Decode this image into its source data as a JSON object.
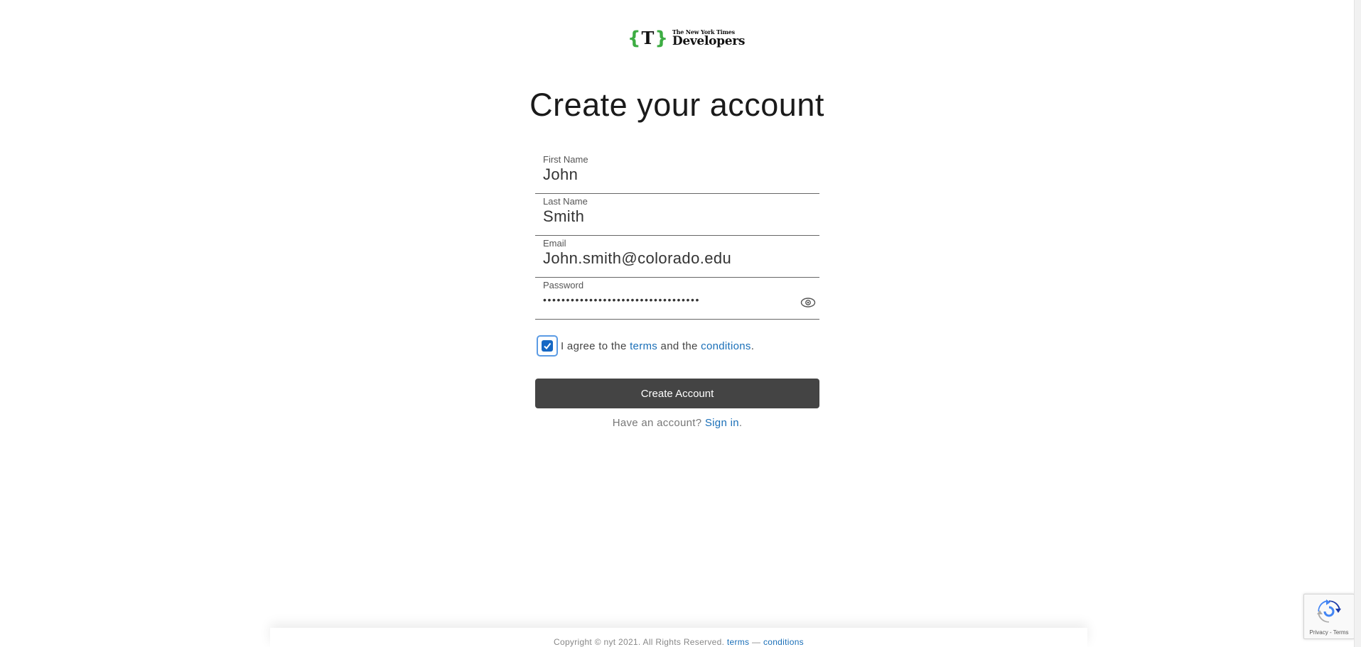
{
  "logo": {
    "brace_left": "{",
    "mark": "T",
    "brace_right": "}",
    "publisher": "The New York Times",
    "product": "Developers"
  },
  "title": "Create your account",
  "form": {
    "first_name": {
      "label": "First Name",
      "value": "John"
    },
    "last_name": {
      "label": "Last Name",
      "value": "Smith"
    },
    "email": {
      "label": "Email",
      "value": "John.smith@colorado.edu"
    },
    "password": {
      "label": "Password",
      "masked_value": "••••••••••••••••••••••••••••••••••",
      "toggle_icon": "eye-icon"
    },
    "agree": {
      "checked": true,
      "prefix": "I agree to the ",
      "terms_link": "terms",
      "middle": " and the ",
      "conditions_link": "conditions",
      "suffix": "."
    },
    "submit_label": "Create Account",
    "have_account_text": "Have an account? ",
    "sign_in_link": "Sign in",
    "sign_in_suffix": "."
  },
  "footer": {
    "copyright": "Copyright © nyt 2021. All Rights Reserved. ",
    "terms_link": "terms",
    "separator": " — ",
    "conditions_link": "conditions"
  },
  "recaptcha": {
    "privacy": "Privacy",
    "separator": " - ",
    "terms": "Terms"
  },
  "colors": {
    "brand_green": "#3dad43",
    "link_blue": "#1a6fb8",
    "button_bg": "#444444",
    "checkbox_blue": "#1668c4"
  }
}
